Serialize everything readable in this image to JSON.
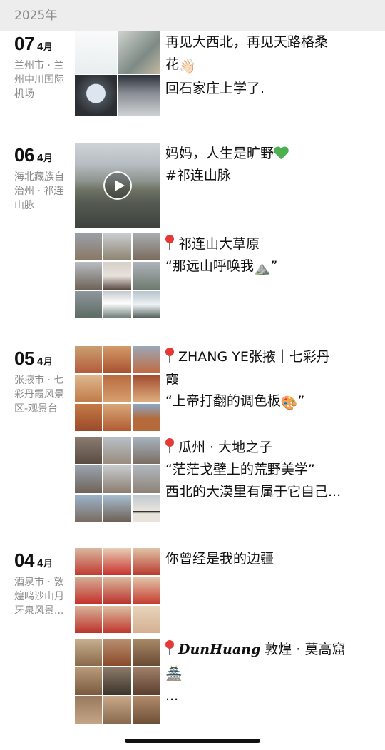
{
  "year_header": "2025年",
  "posts": [
    {
      "day": "07",
      "month": "4月",
      "location": "兰州市 · 兰州中川国际机场",
      "lines": [
        "再见大西北，再见天路格桑",
        "花",
        "回石家庄上学了."
      ],
      "hand_emoji": "👋🏻"
    },
    {
      "day": "06",
      "month": "4月",
      "location": "海北藏族自治州 · 祁连山脉",
      "lines": [
        "妈妈，人生是旷野",
        "#祁连山脉"
      ],
      "second": {
        "lines": [
          "祁连山大草原",
          "“那远山呼唤我",
          "”"
        ],
        "mountain_emoji": "⛰️"
      }
    },
    {
      "day": "05",
      "month": "4月",
      "location": "张掖市 · 七彩丹霞风景区-观景台",
      "lines": [
        "ZHANG YE张掖｜七彩丹",
        "霞",
        "“上帝打翻的调色板",
        "”"
      ],
      "palette_emoji": "🎨",
      "second": {
        "lines": [
          "瓜州 · 大地之子",
          "“茫茫戈壁上的荒野美学”",
          "西北的大漠里有属于它自己..."
        ]
      }
    },
    {
      "day": "04",
      "month": "4月",
      "location": "酒泉市 · 敦煌鸣沙山月牙泉风景...",
      "lines": [
        "你曾经是我的边疆"
      ],
      "second": {
        "title_italic": "DunHuang",
        "title_rest": " 敦煌 · 莫高窟",
        "more": "..."
      },
      "temple_emoji": "🏯"
    }
  ]
}
